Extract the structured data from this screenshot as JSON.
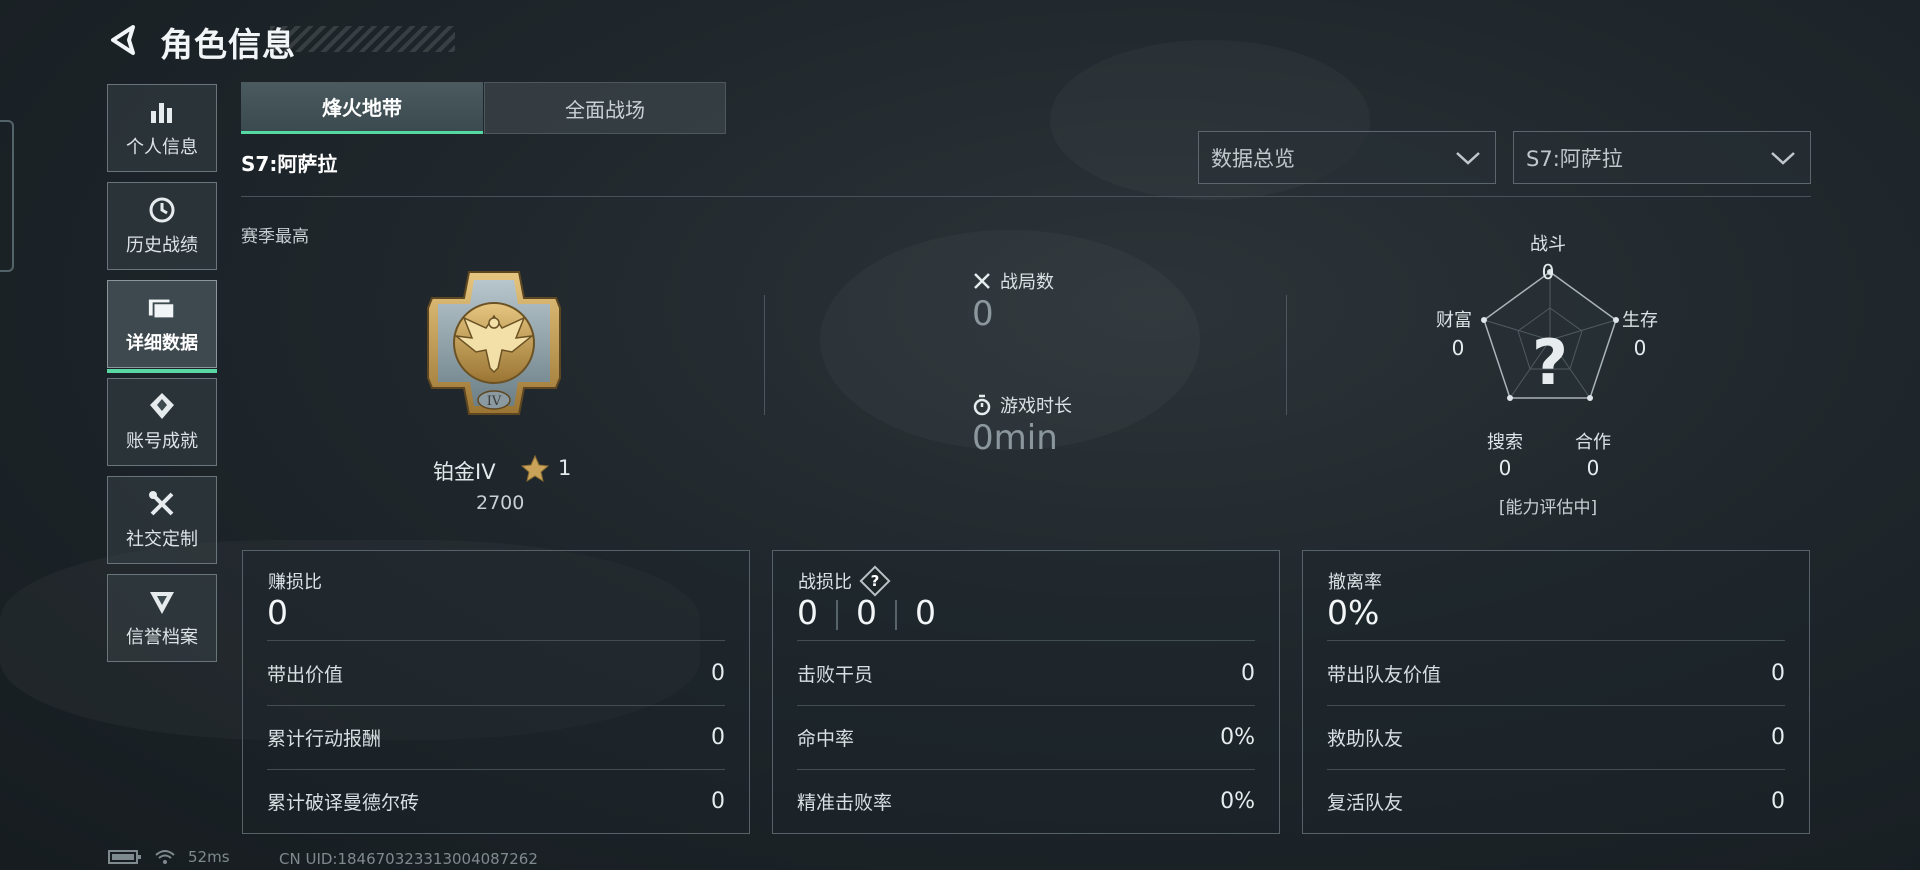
{
  "header": {
    "title": "角色信息"
  },
  "sidebar": {
    "items": [
      {
        "label": "个人信息",
        "icon": "bar-chart-icon"
      },
      {
        "label": "历史战绩",
        "icon": "history-icon"
      },
      {
        "label": "详细数据",
        "icon": "folder-icon",
        "active": true
      },
      {
        "label": "账号成就",
        "icon": "achievement-icon"
      },
      {
        "label": "社交定制",
        "icon": "tools-icon"
      },
      {
        "label": "信誉档案",
        "icon": "shield-emblem-icon"
      }
    ]
  },
  "tabs": [
    {
      "label": "烽火地带",
      "active": true
    },
    {
      "label": "全面战场",
      "active": false
    }
  ],
  "season_label": "S7:阿萨拉",
  "filters": {
    "view": "数据总览",
    "season": "S7:阿萨拉"
  },
  "season_best": {
    "label": "赛季最高",
    "rank_name": "铂金IV",
    "stars": "1",
    "score": "2700",
    "badge_numeral": "IV"
  },
  "overview": {
    "matches_label": "战局数",
    "matches_value": "0",
    "playtime_label": "游戏时长",
    "playtime_value": "0min"
  },
  "radar": {
    "combat_label": "战斗",
    "combat_value": "0",
    "survival_label": "生存",
    "survival_value": "0",
    "cooperation_label": "合作",
    "cooperation_value": "0",
    "search_label": "搜索",
    "search_value": "0",
    "wealth_label": "财富",
    "wealth_value": "0",
    "center_mark": "?",
    "status": "[能力评估中]"
  },
  "panels": {
    "profit": {
      "title": "赚损比",
      "value": "0",
      "rows": [
        {
          "label": "带出价值",
          "value": "0"
        },
        {
          "label": "累计行动报酬",
          "value": "0"
        },
        {
          "label": "累计破译曼德尔砖",
          "value": "0"
        }
      ]
    },
    "kd": {
      "title": "战损比",
      "help": "?",
      "values": [
        "0",
        "0",
        "0"
      ],
      "rows": [
        {
          "label": "击败干员",
          "value": "0"
        },
        {
          "label": "命中率",
          "value": "0%"
        },
        {
          "label": "精准击败率",
          "value": "0%"
        }
      ]
    },
    "extract": {
      "title": "撤离率",
      "value": "0%",
      "rows": [
        {
          "label": "带出队友价值",
          "value": "0"
        },
        {
          "label": "救助队友",
          "value": "0"
        },
        {
          "label": "复活队友",
          "value": "0"
        }
      ]
    }
  },
  "footer": {
    "ping": "52ms",
    "uid": "CN UID:18467032331300408726​2"
  },
  "colors": {
    "accent": "#56d8a3",
    "gold": "#c9a35a"
  }
}
